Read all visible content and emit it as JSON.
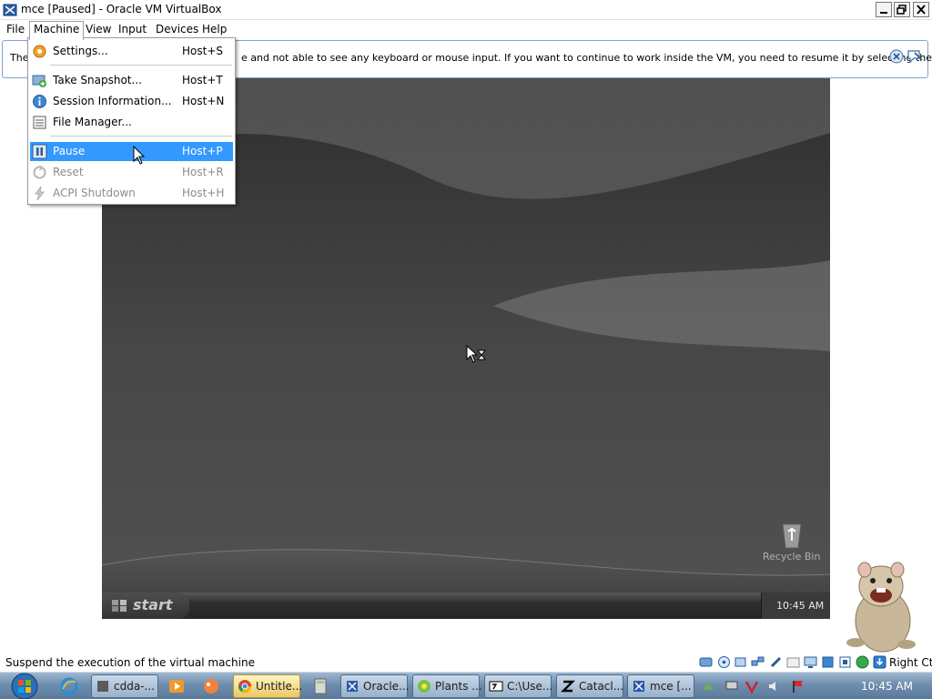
{
  "window": {
    "title": "mce [Paused] - Oracle VM VirtualBox",
    "icon": "virtualbox-icon",
    "controls": [
      "minimize-icon",
      "maximize-icon",
      "close-icon"
    ]
  },
  "menubar": {
    "file": "File",
    "machine": "Machine",
    "view": "View",
    "input": "Input",
    "devices": "Devices",
    "help": "Help"
  },
  "notice": {
    "prefix": "The",
    "text": "e and not able to see any keyboard or mouse input. If you want to continue to work inside the VM, you need to resume it by selecting the"
  },
  "machine_menu": {
    "items": [
      {
        "label": "Settings...",
        "shortcut": "Host+S",
        "icon": "settings-gear-icon",
        "enabled": true
      },
      {
        "label": "Take Snapshot...",
        "shortcut": "Host+T",
        "icon": "snapshot-icon",
        "enabled": true
      },
      {
        "label": "Session Information...",
        "shortcut": "Host+N",
        "icon": "info-icon",
        "enabled": true
      },
      {
        "label": "File Manager...",
        "shortcut": "",
        "icon": "file-manager-icon",
        "enabled": true
      },
      {
        "label": "Pause",
        "shortcut": "Host+P",
        "icon": "pause-icon",
        "enabled": true,
        "highlighted": true
      },
      {
        "label": "Reset",
        "shortcut": "Host+R",
        "icon": "reset-icon",
        "enabled": false
      },
      {
        "label": "ACPI Shutdown",
        "shortcut": "Host+H",
        "icon": "acpi-shutdown-icon",
        "enabled": false
      }
    ]
  },
  "vm": {
    "start_label": "start",
    "clock": "10:45 AM",
    "recycle_bin": "Recycle Bin"
  },
  "statusbar": {
    "text": "Suspend the execution of the virtual machine",
    "host_key": "Right Ctrl"
  },
  "taskbar": {
    "buttons": [
      {
        "label": "cdda-...",
        "icon": "app-icon"
      },
      {
        "label": "Untitle...",
        "icon": "chrome-icon",
        "active": true
      },
      {
        "label": "Oracle...",
        "icon": "virtualbox-icon"
      },
      {
        "label": "Plants ...",
        "icon": "game-icon"
      },
      {
        "label": "C:\\Use...",
        "icon": "7zip-icon"
      },
      {
        "label": "Catacl...",
        "icon": "z-icon"
      },
      {
        "label": "mce [...",
        "icon": "virtualbox-icon"
      }
    ],
    "clock": "10:45 AM"
  },
  "colors": {
    "menu_highlight": "#3399ff",
    "taskbar": "#6f8eae",
    "vm_background": "#3b3b3b"
  }
}
